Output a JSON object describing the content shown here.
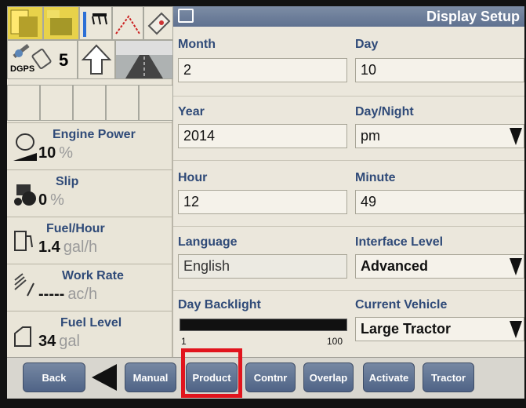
{
  "header": {
    "title": "Display Setup"
  },
  "status": {
    "gps_label": "DGPS",
    "signal_count": "5"
  },
  "gauges": [
    {
      "label": "Engine Power",
      "value": "10",
      "unit": "%"
    },
    {
      "label": "Slip",
      "value": "0",
      "unit": "%"
    },
    {
      "label": "Fuel/Hour",
      "value": "1.4",
      "unit": "gal/h"
    },
    {
      "label": "Work Rate",
      "value": "-----",
      "unit": "ac/h"
    },
    {
      "label": "Fuel Level",
      "value": "34",
      "unit": "gal"
    }
  ],
  "form": {
    "month_label": "Month",
    "month_value": "2",
    "day_label": "Day",
    "day_value": "10",
    "year_label": "Year",
    "year_value": "2014",
    "daynight_label": "Day/Night",
    "daynight_value": "pm",
    "hour_label": "Hour",
    "hour_value": "12",
    "minute_label": "Minute",
    "minute_value": "49",
    "language_label": "Language",
    "language_value": "English",
    "interface_label": "Interface Level",
    "interface_value": "Advanced",
    "backlight_label": "Day Backlight",
    "backlight_min": "1",
    "backlight_max": "100",
    "vehicle_label": "Current Vehicle",
    "vehicle_value": "Large Tractor"
  },
  "bottom": {
    "back": "Back",
    "manual": "Manual",
    "product": "Product",
    "contnr": "Contnr",
    "overlap": "Overlap",
    "activate": "Activate",
    "tractor": "Tractor"
  },
  "colors": {
    "accent": "#2f4a78",
    "highlight": "#e1141d"
  }
}
